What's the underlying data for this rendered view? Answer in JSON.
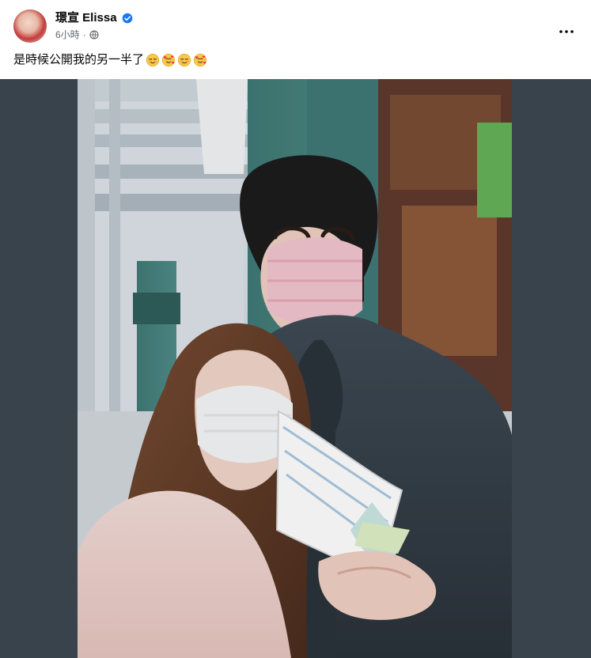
{
  "post": {
    "author": "璟宣 Elissa",
    "verified": true,
    "timestamp": "6小時",
    "privacy_icon": "globe-icon",
    "caption_text": "是時候公開我的另一半了",
    "emojis": [
      "relieved-face",
      "smiling-face-with-hearts",
      "relieved-face",
      "smiling-face-with-hearts"
    ],
    "more_icon": "more-options-icon"
  },
  "colors": {
    "name_text": "#050505",
    "meta_text": "#65676b",
    "verified_blue": "#1877f2",
    "media_bg": "#38434c"
  }
}
